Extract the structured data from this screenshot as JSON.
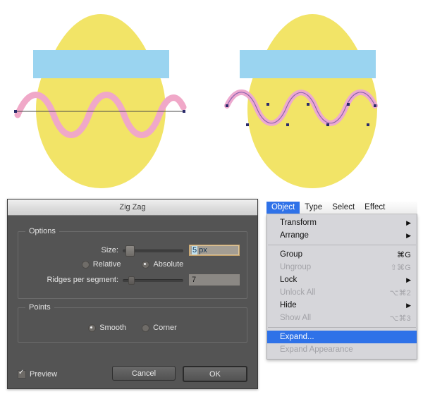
{
  "illustration": {
    "colors": {
      "egg": "#f2e467",
      "band": "#9ad4f0",
      "wave": "#f0a8c8",
      "wave_expanded_fill": "#eda9cf",
      "wave_expanded_stroke": "#8a5fb0",
      "path_line": "#4a4a4a",
      "anchor": "#2b2b6b",
      "background": "#ffffff"
    },
    "left_label": "egg-with-live-zigzag-effect",
    "right_label": "egg-with-expanded-zigzag-path"
  },
  "dialog": {
    "title": "Zig Zag",
    "options": {
      "legend": "Options",
      "size_label": "Size:",
      "size_value": "5",
      "size_unit": "px",
      "size_value_full": "5 px",
      "relative_label": "Relative",
      "absolute_label": "Absolute",
      "selected_mode": "Absolute",
      "ridges_label": "Ridges per segment:",
      "ridges_value": "7"
    },
    "points": {
      "legend": "Points",
      "smooth_label": "Smooth",
      "corner_label": "Corner",
      "selected_point": "Smooth"
    },
    "footer": {
      "preview_label": "Preview",
      "preview_checked": true,
      "cancel_label": "Cancel",
      "ok_label": "OK"
    }
  },
  "menu": {
    "menubar": [
      {
        "label": "Object",
        "active": true
      },
      {
        "label": "Type",
        "active": false
      },
      {
        "label": "Select",
        "active": false
      },
      {
        "label": "Effect",
        "active": false
      }
    ],
    "items": [
      {
        "label": "Transform",
        "shortcut": "",
        "submenu": true,
        "disabled": false,
        "selected": false
      },
      {
        "label": "Arrange",
        "shortcut": "",
        "submenu": true,
        "disabled": false,
        "selected": false
      },
      {
        "separator": true
      },
      {
        "label": "Group",
        "shortcut": "⌘G",
        "submenu": false,
        "disabled": false,
        "selected": false
      },
      {
        "label": "Ungroup",
        "shortcut": "⇧⌘G",
        "submenu": false,
        "disabled": true,
        "selected": false
      },
      {
        "label": "Lock",
        "shortcut": "",
        "submenu": true,
        "disabled": false,
        "selected": false
      },
      {
        "label": "Unlock All",
        "shortcut": "⌥⌘2",
        "submenu": false,
        "disabled": true,
        "selected": false
      },
      {
        "label": "Hide",
        "shortcut": "",
        "submenu": true,
        "disabled": false,
        "selected": false
      },
      {
        "label": "Show All",
        "shortcut": "⌥⌘3",
        "submenu": false,
        "disabled": true,
        "selected": false
      },
      {
        "separator": true
      },
      {
        "label": "Expand...",
        "shortcut": "",
        "submenu": false,
        "disabled": false,
        "selected": true
      },
      {
        "label": "Expand Appearance",
        "shortcut": "",
        "submenu": false,
        "disabled": true,
        "selected": false
      }
    ]
  }
}
